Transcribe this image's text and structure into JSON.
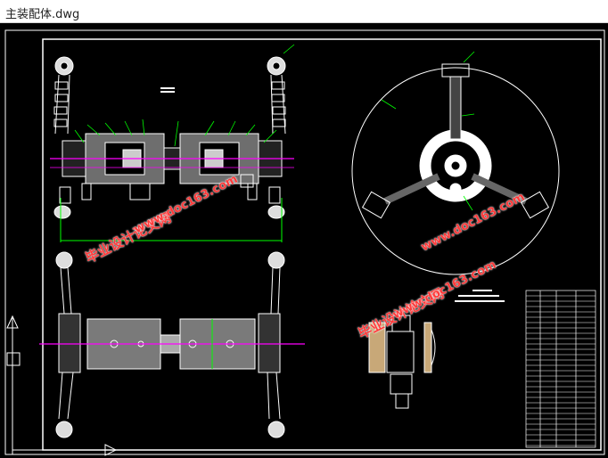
{
  "window": {
    "title": "主装配体.dwg"
  },
  "watermark": {
    "brand": "毕业设计论文网",
    "url": "www.doc163.com"
  },
  "colors": {
    "background": "#000000",
    "lines": "#ffffff",
    "leaders": "#00ff00",
    "axis": "#ff00ff",
    "dimension": "#00ff00",
    "watermark": "#ff3b3b"
  },
  "icons": [
    "ucs-icon"
  ]
}
